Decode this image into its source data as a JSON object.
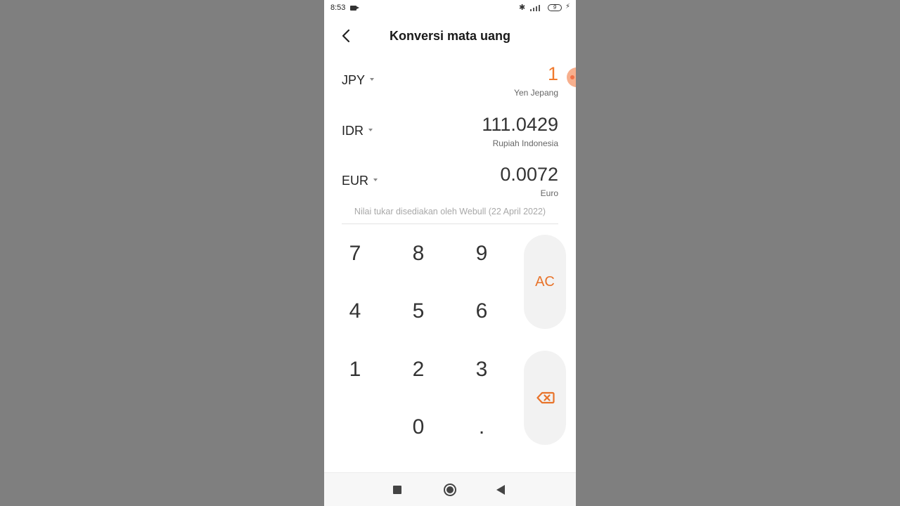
{
  "status_bar": {
    "time": "8:53",
    "battery": "9",
    "icons": [
      "screen-record-icon",
      "bluetooth-icon",
      "signal-icon",
      "battery-icon",
      "charging-icon"
    ]
  },
  "header": {
    "title": "Konversi mata uang",
    "back_icon": "chevron-left-icon"
  },
  "currencies": [
    {
      "code": "JPY",
      "amount": "1",
      "name": "Yen Jepang",
      "active": true
    },
    {
      "code": "IDR",
      "amount": "111.0429",
      "name": "Rupiah Indonesia",
      "active": false
    },
    {
      "code": "EUR",
      "amount": "0.0072",
      "name": "Euro",
      "active": false
    }
  ],
  "rate_note": "Nilai tukar disediakan oleh Webull (22 April 2022)",
  "keypad": {
    "keys": {
      "k7": "7",
      "k8": "8",
      "k9": "9",
      "k4": "4",
      "k5": "5",
      "k6": "6",
      "k1": "1",
      "k2": "2",
      "k3": "3",
      "k0": "0",
      "dot": "."
    },
    "clear_label": "AC",
    "backspace_icon": "backspace-icon"
  },
  "nav_bar": {
    "icons": [
      "recent-apps-icon",
      "home-icon",
      "back-icon"
    ]
  },
  "colors": {
    "accent": "#f07a2e",
    "background_outside": "#7f7f7f",
    "side_key_bg": "#f2f2f2"
  }
}
